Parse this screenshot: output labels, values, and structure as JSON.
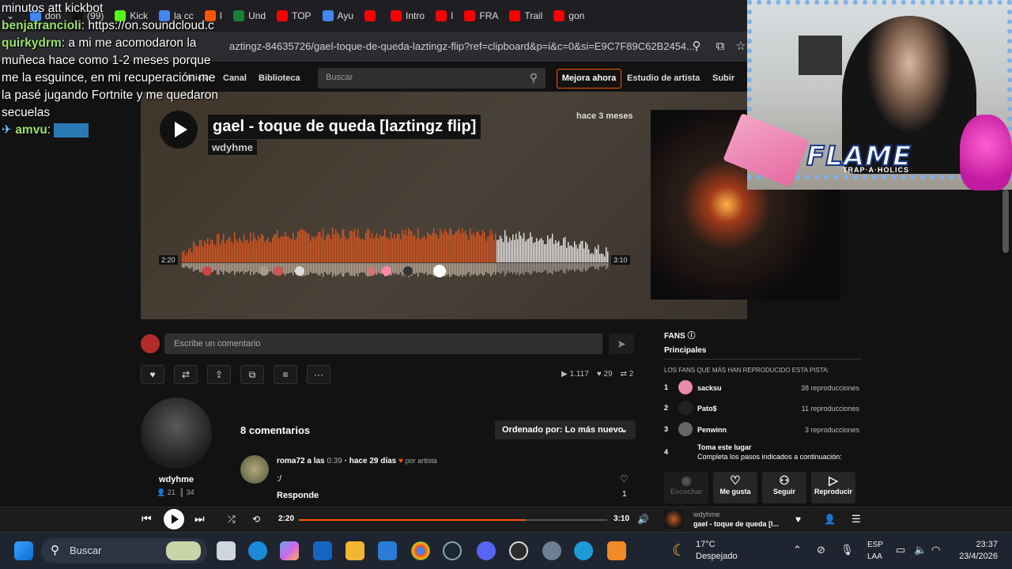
{
  "browser": {
    "tabs": [
      {
        "label": "don",
        "color": "#4285f4"
      },
      {
        "label": "(99)",
        "color": "#111111"
      },
      {
        "label": "Kick",
        "color": "#53fc18"
      },
      {
        "label": "la cc",
        "color": "#4285f4"
      },
      {
        "label": "I",
        "color": "#ff5500"
      },
      {
        "label": "Und",
        "color": "#1a7f37"
      },
      {
        "label": "TOP",
        "color": "#ff0000"
      },
      {
        "label": "Ayu",
        "color": "#4285f4"
      },
      {
        "label": "",
        "color": "#ff0000"
      },
      {
        "label": "Intro",
        "color": "#ff0000"
      },
      {
        "label": "I",
        "color": "#ff0000"
      },
      {
        "label": "FRA",
        "color": "#ff0000"
      },
      {
        "label": "Trail",
        "color": "#ff0000"
      },
      {
        "label": "gon",
        "color": "#ff0000"
      }
    ],
    "url": "aztingz-84635726/gael-toque-de-queda-laztingz-flip?ref=clipboard&p=i&c=0&si=E9C7F89C62B2454..."
  },
  "soundcloud": {
    "nav": {
      "home": "Inicio",
      "feed": "Canal",
      "library": "Biblioteca",
      "search_placeholder": "Buscar",
      "upgrade": "Mejora ahora",
      "artist_studio": "Estudio de artista",
      "upload": "Subir"
    },
    "track": {
      "title": "gael - toque de queda [laztingz flip]",
      "artist": "wdyhme",
      "posted": "hace 3 meses",
      "current_time": "2:20",
      "duration": "3:10",
      "progress": 0.737
    },
    "comment_placeholder": "Escribe un comentario",
    "stats": {
      "plays": "1.117",
      "likes": "29",
      "reposts": "2"
    },
    "uploader": {
      "name": "wdyhme",
      "followers": "21",
      "tracks": "34"
    },
    "comments": {
      "count_label": "8 comentarios",
      "sort_label": "Ordenado por: Lo más nuevo",
      "items": [
        {
          "user": "roma72",
          "at_word": "a las",
          "time": "0:39",
          "ago": "· hace 29 días",
          "badge": "por artista",
          "text": ":/",
          "reply": "Responde",
          "likes": "1"
        }
      ]
    },
    "fans": {
      "title": "FANS",
      "tab": "Principales",
      "subtitle": "LOS FANS QUE MÁS HAN REPRODUCIDO ESTA PISTA:",
      "list": [
        {
          "rank": "1",
          "name": "sacksu",
          "plays": "38 reproducciones",
          "color": "#e98aa8"
        },
        {
          "rank": "2",
          "name": "Pato$",
          "plays": "11 reproducciones",
          "color": "#222222"
        },
        {
          "rank": "3",
          "name": "Penwinn",
          "plays": "3 reproducciones",
          "color": "#666666"
        }
      ],
      "slot4_rank": "4",
      "slot4_title": "Toma este lugar",
      "slot4_desc": "Completa los pasos indicados a continuación:",
      "actions": {
        "listen": "Escuchar",
        "like": "Me gusta",
        "follow": "Seguir",
        "play": "Reproducir"
      }
    }
  },
  "player": {
    "current": "2:20",
    "duration": "3:10",
    "artist": "wdyhme",
    "title": "gael - toque de queda [l...",
    "progress": 0.737
  },
  "chat": [
    {
      "user": "",
      "text": "minutos att kickbot",
      "color": "#ffffff"
    },
    {
      "user": "benjafrancioli",
      "text": ": https://on.soundcloud.c",
      "color": "#9be36b"
    },
    {
      "user": "quirkydrm",
      "text": ": a mi me acomodaron la muñeca hace como 1-2 meses porque me la esguince, en mi recuperación me la pasé jugando Fortnite y me quedaron secuelas",
      "color": "#9be36b"
    },
    {
      "user": "amvu",
      "text": ":",
      "color": "#9be36b"
    }
  ],
  "overlay": {
    "brand": "FLAME",
    "brand_sub": "TRAP·A·HOLICS"
  },
  "taskbar": {
    "search": "Buscar",
    "weather_temp": "17°C",
    "weather_desc": "Despejado",
    "lang1": "ESP",
    "lang2": "LAA",
    "time": "23:37",
    "date": "23/4/2026"
  }
}
